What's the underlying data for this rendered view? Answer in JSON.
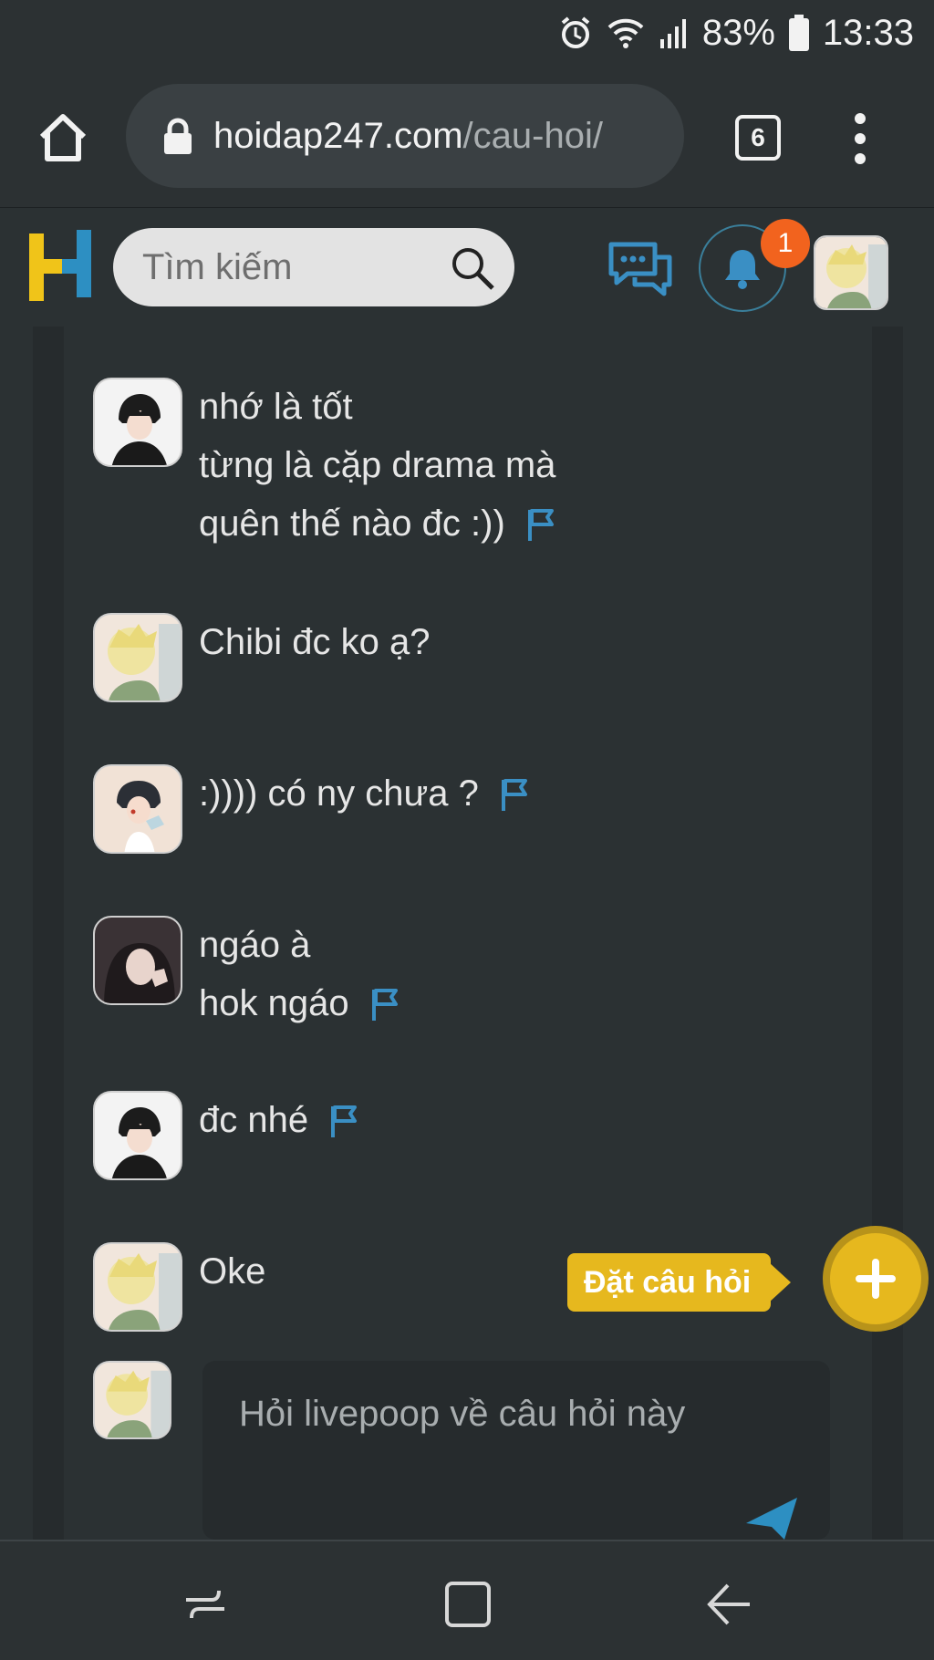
{
  "status_bar": {
    "battery": "83%",
    "time": "13:33",
    "icons": [
      "alarm-icon",
      "wifi-icon",
      "signal-icon",
      "battery-icon"
    ]
  },
  "browser": {
    "url_domain": "hoidap247.com",
    "url_path": "/cau-hoi/",
    "tab_count": "6",
    "icons": [
      "home-icon",
      "lock-icon",
      "tabs-icon",
      "menu-icon"
    ]
  },
  "header": {
    "search_placeholder": "Tìm kiếm",
    "notification_count": "1",
    "icons": [
      "logo-icon",
      "search-icon",
      "chat-icon",
      "bell-icon"
    ]
  },
  "comments": [
    {
      "lines": [
        "nhớ là tốt",
        "từng là cặp drama mà",
        "quên thế nào đc :))"
      ],
      "flag": true,
      "avatar": "dark-hair-avatar"
    },
    {
      "lines": [
        "Chibi đc ko ạ?"
      ],
      "flag": false,
      "avatar": "blonde-avatar"
    },
    {
      "lines": [
        ":)))) có ny chưa ?"
      ],
      "flag": true,
      "avatar": "boy-avatar"
    },
    {
      "lines": [
        "ngáo à",
        "hok ngáo"
      ],
      "flag": true,
      "avatar": "girl-avatar"
    },
    {
      "lines": [
        "đc nhé"
      ],
      "flag": true,
      "avatar": "dark-hair-avatar"
    },
    {
      "lines": [
        "Oke"
      ],
      "flag": false,
      "avatar": "blonde-avatar"
    }
  ],
  "reply": {
    "placeholder": "Hỏi livepoop về câu hỏi này"
  },
  "ask_button": {
    "label": "Đặt câu hỏi"
  },
  "colors": {
    "accent_yellow": "#e6b81e",
    "accent_blue": "#3a8fc4",
    "badge_orange": "#f2631e",
    "background": "#2b3133"
  }
}
